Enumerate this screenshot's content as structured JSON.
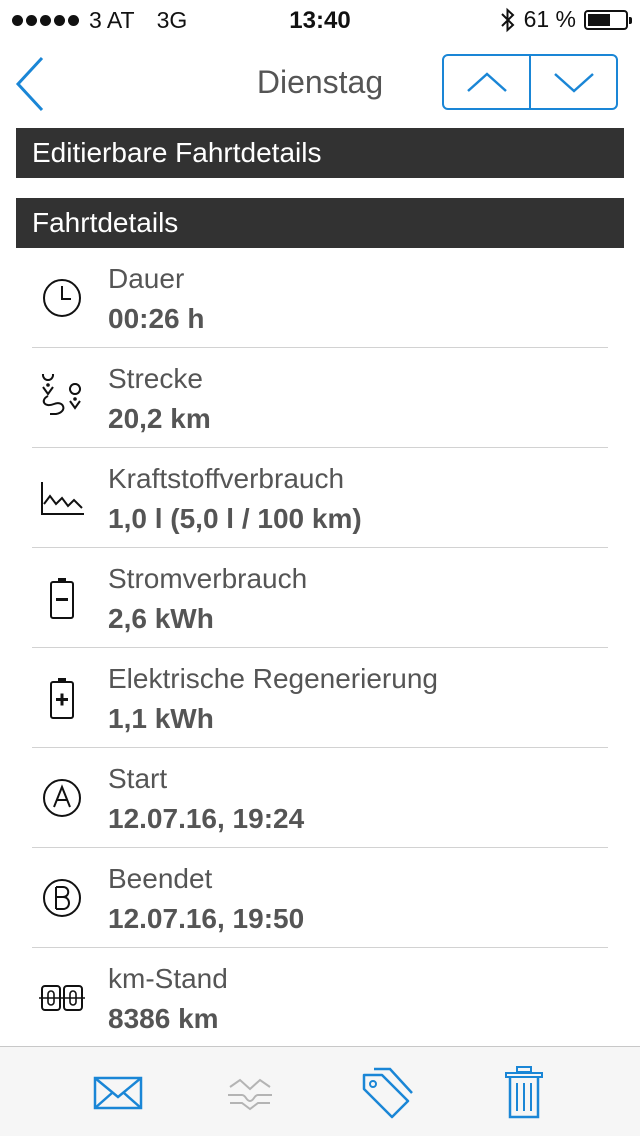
{
  "status_bar": {
    "carrier": "3 AT",
    "network": "3G",
    "time": "13:40",
    "battery_percent": "61 %",
    "battery_level": 0.61
  },
  "nav": {
    "title": "Dienstag"
  },
  "sections": {
    "editable": "Editierbare Fahrtdetails",
    "details": "Fahrtdetails"
  },
  "rows": [
    {
      "icon": "clock-icon",
      "label": "Dauer",
      "value": "00:26 h"
    },
    {
      "icon": "route-icon",
      "label": "Strecke",
      "value": "20,2 km"
    },
    {
      "icon": "consumption-chart-icon",
      "label": "Kraftstoffverbrauch",
      "value": "1,0 l (5,0 l / 100 km)"
    },
    {
      "icon": "battery-minus-icon",
      "label": "Stromverbrauch",
      "value": "2,6 kWh"
    },
    {
      "icon": "battery-plus-icon",
      "label": "Elektrische Regenerierung",
      "value": "1,1 kWh"
    },
    {
      "icon": "start-a-icon",
      "label": "Start",
      "value": "12.07.16, 19:24"
    },
    {
      "icon": "end-b-icon",
      "label": "Beendet",
      "value": "12.07.16, 19:50"
    },
    {
      "icon": "odometer-icon",
      "label": "km-Stand",
      "value": "8386 km"
    }
  ],
  "colors": {
    "accent": "#1a86d6",
    "section_bg": "#323232",
    "text": "#555555",
    "disabled": "#b4b4b4"
  },
  "tabbar": {
    "icons": [
      "mail-icon",
      "share-icon",
      "tag-icon",
      "trash-icon"
    ]
  }
}
